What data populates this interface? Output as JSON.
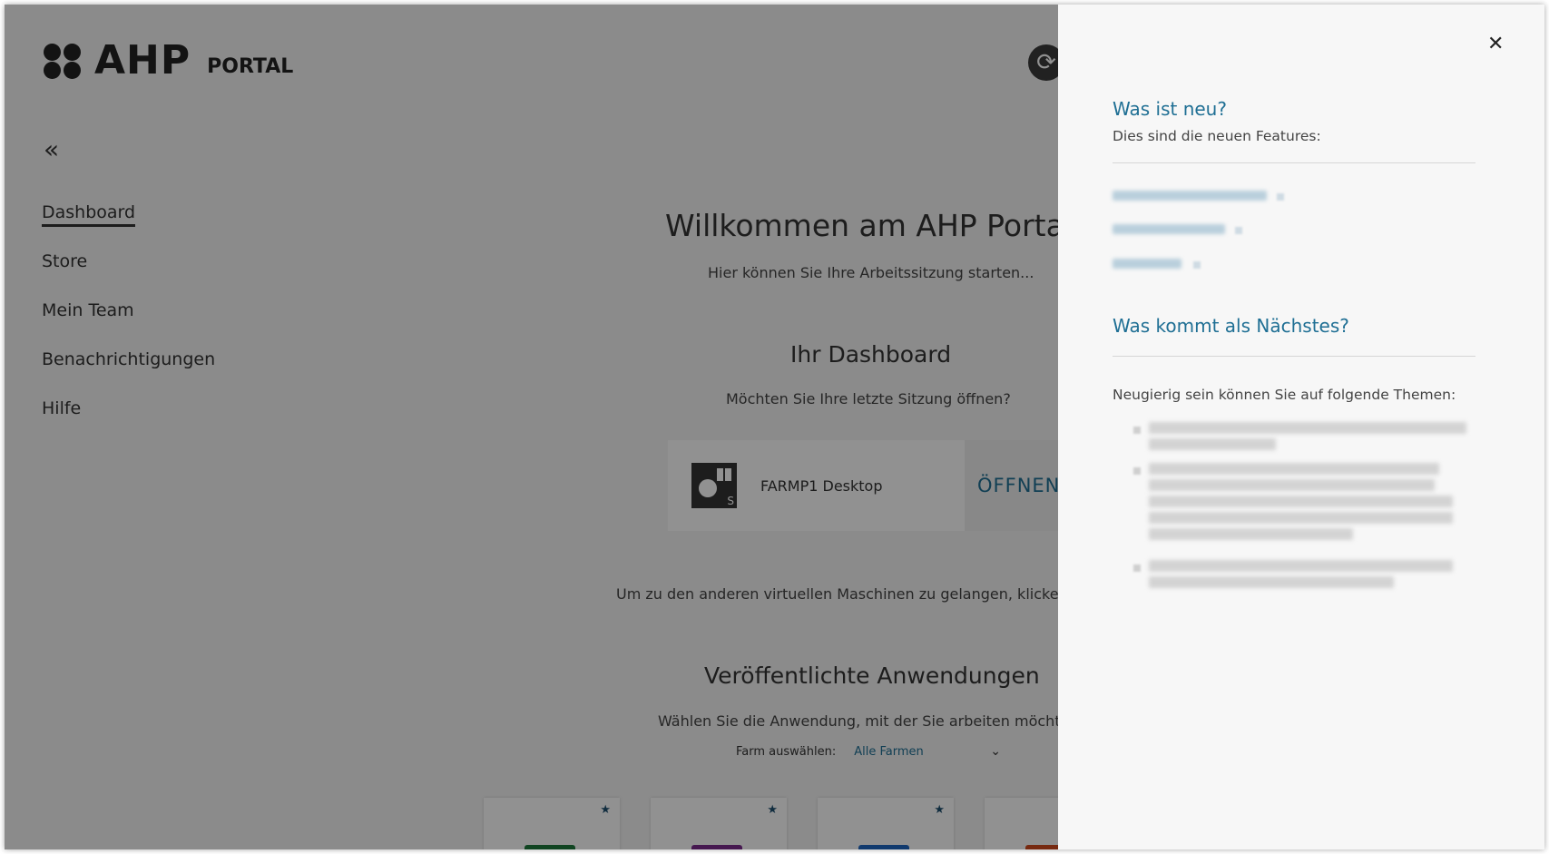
{
  "logo": {
    "brand": "AHP",
    "product": "PORTAL"
  },
  "header": {
    "refresh_icon": "refresh-icon"
  },
  "sidebar": {
    "collapse_icon": "double-chevron-left-icon",
    "items": [
      {
        "label": "Dashboard",
        "active": true
      },
      {
        "label": "Store"
      },
      {
        "label": "Mein Team"
      },
      {
        "label": "Benachrichtigungen"
      },
      {
        "label": "Hilfe"
      }
    ]
  },
  "main": {
    "welcome_title": "Willkommen am AHP Porta",
    "welcome_subtitle": "Hier können Sie Ihre Arbeitssitzung starten...",
    "dashboard_title": "Ihr Dashboard",
    "dashboard_subtitle": "Möchten Sie Ihre letzte Sitzung öffnen?",
    "session": {
      "name": "FARMP1 Desktop",
      "open_label": "ÖFFNEN",
      "icon": "windows-desktop-icon"
    },
    "vm_hint": "Um zu den anderen virtuellen Maschinen zu gelangen, klicken",
    "apps_title": "Veröffentlichte Anwendungen",
    "apps_subtitle": "Wählen Sie die Anwendung, mit der Sie arbeiten möchte",
    "farm_label": "Farm auswählen:",
    "farm_value": "Alle Farmen",
    "app_tile_colors": [
      "#1e7a3c",
      "#7b2b8e",
      "#1f66c2",
      "#d24a1e"
    ]
  },
  "panel": {
    "close_icon": "close-icon",
    "new_title": "Was ist neu?",
    "new_subtitle": "Dies sind die neuen Features:",
    "next_title": "Was kommt als Nächstes?",
    "next_intro": "Neugierig sein können Sie auf folgende Themen:"
  },
  "colors": {
    "accent": "#1f6f94",
    "overlay": "rgba(0,0,0,0.43)",
    "panel_bg": "#f7f7f7"
  }
}
